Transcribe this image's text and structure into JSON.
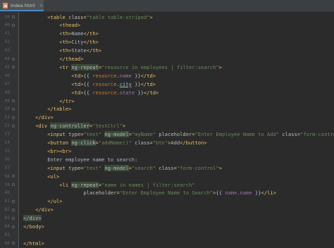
{
  "tab": {
    "label": "index.html",
    "close": "×",
    "icon": "html-file-icon"
  },
  "lines": [
    {
      "n": "39",
      "i": 4,
      "s": [
        [
          "t",
          "<table "
        ],
        [
          "a",
          "class"
        ],
        [
          "t",
          "="
        ],
        [
          "s",
          "\"table table-striped\""
        ],
        [
          "t",
          ">"
        ]
      ]
    },
    {
      "n": "40",
      "i": 6,
      "s": [
        [
          "t",
          "<thead>"
        ]
      ]
    },
    {
      "n": "41",
      "i": 6,
      "s": [
        [
          "t",
          "<th>"
        ],
        [
          "tx",
          "Name"
        ],
        [
          "t",
          "</th>"
        ]
      ]
    },
    {
      "n": "42",
      "i": 6,
      "s": [
        [
          "t",
          "<th>"
        ],
        [
          "tx",
          "City"
        ],
        [
          "t",
          "</th>"
        ]
      ]
    },
    {
      "n": "43",
      "i": 6,
      "s": [
        [
          "t",
          "<th>"
        ],
        [
          "tx",
          "State"
        ],
        [
          "t",
          "</th>"
        ]
      ]
    },
    {
      "n": "44",
      "i": 6,
      "s": [
        [
          "t",
          "</thead>"
        ]
      ]
    },
    {
      "n": "45",
      "i": 6,
      "s": [
        [
          "t",
          "<tr "
        ],
        [
          "ng",
          "ng-repeat"
        ],
        [
          "t",
          "="
        ],
        [
          "s",
          "\"resource in employees | filter:search\""
        ],
        [
          "t",
          ">"
        ]
      ]
    },
    {
      "n": "46",
      "i": 8,
      "s": [
        [
          "t",
          "<td>"
        ],
        [
          "tx",
          "{{ "
        ],
        [
          "v",
          "resource"
        ],
        [
          "tx",
          "."
        ],
        [
          "m",
          "name"
        ],
        [
          "tx",
          " }}"
        ],
        [
          "t",
          "</td>"
        ]
      ]
    },
    {
      "n": "47",
      "i": 8,
      "s": [
        [
          "t",
          "<td>"
        ],
        [
          "tx",
          "{{ "
        ],
        [
          "v",
          "resource"
        ],
        [
          "tx",
          "."
        ],
        [
          "hl",
          "city"
        ],
        [
          "tx",
          " }}"
        ],
        [
          "t",
          "</td>"
        ]
      ]
    },
    {
      "n": "48",
      "i": 8,
      "s": [
        [
          "t",
          "<td>"
        ],
        [
          "tx",
          "{{ "
        ],
        [
          "v",
          "resource"
        ],
        [
          "tx",
          "."
        ],
        [
          "m",
          "state"
        ],
        [
          "tx",
          " }}"
        ],
        [
          "t",
          "</td>"
        ]
      ]
    },
    {
      "n": "49",
      "i": 6,
      "s": [
        [
          "t",
          "</tr>"
        ]
      ]
    },
    {
      "n": "50",
      "i": 4,
      "s": [
        [
          "t",
          "</table>"
        ]
      ]
    },
    {
      "n": "51",
      "i": 2,
      "s": [
        [
          "t",
          "</div>"
        ]
      ]
    },
    {
      "n": "52",
      "i": 2,
      "s": [
        [
          "t",
          "<div "
        ],
        [
          "ng",
          "ng-controller"
        ],
        [
          "t",
          "="
        ],
        [
          "s",
          "\"testCtrl\""
        ],
        [
          "t",
          ">"
        ]
      ]
    },
    {
      "n": "53",
      "i": 4,
      "s": [
        [
          "t",
          "<input "
        ],
        [
          "a",
          "type"
        ],
        [
          "t",
          "="
        ],
        [
          "s",
          "\"text\" "
        ],
        [
          "ng",
          "ng-model"
        ],
        [
          "t",
          "="
        ],
        [
          "s",
          "\"myName\" "
        ],
        [
          "a",
          "placeholder"
        ],
        [
          "t",
          "="
        ],
        [
          "s",
          "\"Enter Employee Name to Add\" "
        ],
        [
          "a",
          "class"
        ],
        [
          "t",
          "="
        ],
        [
          "s",
          "\"form-control\""
        ],
        [
          "t",
          ">"
        ]
      ]
    },
    {
      "n": "54",
      "i": 4,
      "s": [
        [
          "t",
          "<button "
        ],
        [
          "ng",
          "ng-click"
        ],
        [
          "t",
          "="
        ],
        [
          "s",
          "\"addName()\" "
        ],
        [
          "a",
          "class"
        ],
        [
          "t",
          "="
        ],
        [
          "s",
          "\"btn\""
        ],
        [
          "t",
          ">"
        ],
        [
          "tx",
          "Add"
        ],
        [
          "t",
          "</button>"
        ]
      ]
    },
    {
      "n": "55",
      "i": 4,
      "s": [
        [
          "t",
          "<br><br>"
        ]
      ]
    },
    {
      "n": "56",
      "i": 4,
      "s": [
        [
          "tx",
          "Enter employee name to search:"
        ]
      ]
    },
    {
      "n": "57",
      "i": 4,
      "s": [
        [
          "t",
          "<input "
        ],
        [
          "a",
          "type"
        ],
        [
          "t",
          "="
        ],
        [
          "s",
          "\"text\" "
        ],
        [
          "ng",
          "ng-model"
        ],
        [
          "t",
          "="
        ],
        [
          "s",
          "\"search\" "
        ],
        [
          "a",
          "class"
        ],
        [
          "t",
          "="
        ],
        [
          "s",
          "\"form-control\""
        ],
        [
          "t",
          ">"
        ]
      ]
    },
    {
      "n": "58",
      "i": 4,
      "s": [
        [
          "t",
          "<ul>"
        ]
      ]
    },
    {
      "n": "59",
      "i": 6,
      "s": [
        [
          "t",
          "<li "
        ],
        [
          "ng",
          "ng-repeat"
        ],
        [
          "t",
          "="
        ],
        [
          "s",
          "\"name in names | filter:search\""
        ]
      ]
    },
    {
      "n": "60",
      "i": 10,
      "s": [
        [
          "a",
          "placeholder"
        ],
        [
          "t",
          "="
        ],
        [
          "s",
          "\"Enter Employee Name to Search\""
        ],
        [
          "t",
          ">"
        ],
        [
          "tx",
          "{{ "
        ],
        [
          "m",
          "name"
        ],
        [
          "tx",
          "."
        ],
        [
          "m",
          "name"
        ],
        [
          "tx",
          " }}"
        ],
        [
          "t",
          "</li>"
        ]
      ]
    },
    {
      "n": "61",
      "i": 4,
      "s": [
        [
          "t",
          "</ul>"
        ]
      ]
    },
    {
      "n": "62",
      "i": 2,
      "s": [
        [
          "t",
          "</div>"
        ]
      ]
    },
    {
      "n": "63",
      "i": 0,
      "s": [
        [
          "br",
          "</div>"
        ]
      ]
    },
    {
      "n": "64",
      "i": 0,
      "s": [
        [
          "t",
          "</body>"
        ]
      ]
    },
    {
      "n": "65",
      "i": 0,
      "s": []
    },
    {
      "n": "66",
      "i": 0,
      "s": [
        [
          "t",
          "</html>"
        ]
      ]
    }
  ]
}
